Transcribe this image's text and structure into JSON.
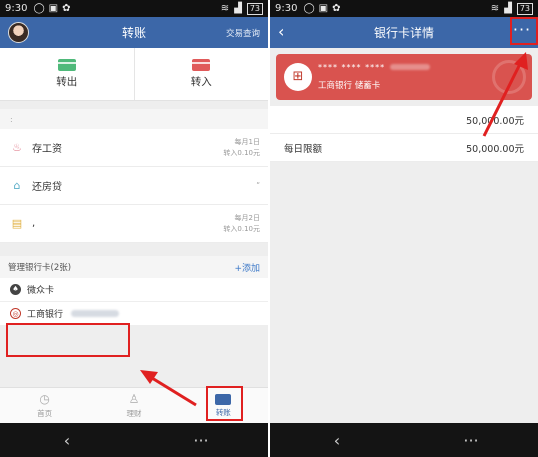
{
  "status": {
    "time": "9:30",
    "battery": "73"
  },
  "left": {
    "title": "转账",
    "header_link": "交易查询",
    "transfer_out": "转出",
    "transfer_in": "转入",
    "hint": ":",
    "plans": [
      {
        "name": "存工资",
        "meta1": "每月1日",
        "meta2": "转入0.10元",
        "icon": "piggy-bank-icon"
      },
      {
        "name": "还房贷",
        "meta1": "",
        "meta2": "",
        "icon": "house-icon",
        "tail": "“"
      },
      {
        "name": ",",
        "meta1": "每月2日",
        "meta2": "转入0.10元",
        "icon": "document-icon"
      }
    ],
    "cards_header": "管理银行卡(2张)",
    "add_label": "+添加",
    "cards": [
      {
        "name": "微众卡"
      },
      {
        "name": "工商银行"
      }
    ],
    "tabs": [
      {
        "label": "首页"
      },
      {
        "label": "理财"
      },
      {
        "label": "转账"
      }
    ]
  },
  "right": {
    "title": "银行卡详情",
    "card_number": "**** **** ****",
    "card_bank": "工商银行 储蓄卡",
    "rows": [
      {
        "label": "",
        "value": "50,000.00元"
      },
      {
        "label": "每日限额",
        "value": "50,000.00元"
      }
    ]
  },
  "nav": {
    "back": "‹",
    "menu": "···"
  },
  "colors": {
    "header": "#3c67a8",
    "card": "#d9534f",
    "highlight": "#e02020"
  }
}
